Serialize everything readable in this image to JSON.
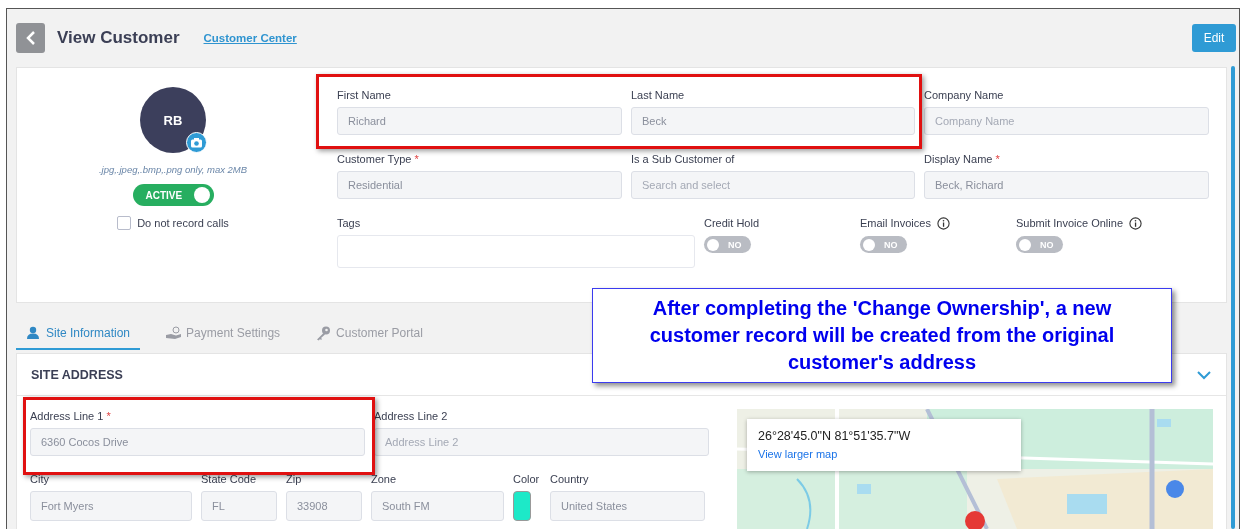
{
  "header": {
    "title": "View Customer",
    "link": "Customer Center",
    "edit_button": "Edit"
  },
  "profile": {
    "initials": "RB",
    "upload_hint": ".jpg,.jpeg,.bmp,.png only, max 2MB",
    "status": {
      "label": "ACTIVE",
      "on": true
    },
    "do_not_record": {
      "label": "Do not record calls",
      "checked": false
    }
  },
  "fields": [
    {
      "label": "First Name",
      "value": "Richard"
    },
    {
      "label": "Last Name",
      "value": "Beck"
    },
    {
      "label": "Company Name",
      "placeholder": "Company Name"
    },
    {
      "label": "Customer Type",
      "required_mark": "*",
      "value": "Residential"
    },
    {
      "label": "Is a Sub Customer of",
      "placeholder": "Search and select"
    },
    {
      "label": "Display Name",
      "required_mark": "*",
      "value": "Beck, Richard"
    }
  ],
  "tags": {
    "label": "Tags"
  },
  "switches": [
    {
      "label": "Credit Hold",
      "info": false,
      "text": "NO",
      "on": false
    },
    {
      "label": "Email Invoices",
      "info": true,
      "text": "NO",
      "on": false
    },
    {
      "label": "Submit Invoice Online",
      "info": true,
      "text": "NO",
      "on": false
    }
  ],
  "tabs": [
    {
      "label": "Site Information",
      "kind": "person",
      "selected": true
    },
    {
      "label": "Payment Settings",
      "kind": "payment",
      "selected": false
    },
    {
      "label": "Customer Portal",
      "kind": "key",
      "selected": false
    }
  ],
  "site_address": {
    "title": "SITE ADDRESS",
    "expanded": true,
    "fields": [
      {
        "label": "Address Line 1",
        "required_mark": "*",
        "value": "6360 Cocos Drive"
      },
      {
        "label": "Address Line 2",
        "placeholder": "Address Line 2"
      }
    ],
    "bottom_fields": [
      {
        "kind": "text",
        "label": "City",
        "value": "Fort Myers"
      },
      {
        "kind": "text",
        "label": "State Code",
        "value": "FL"
      },
      {
        "kind": "text",
        "label": "Zip",
        "value": "33908"
      },
      {
        "kind": "text",
        "label": "Zone",
        "value": "South FM"
      },
      {
        "kind": "color",
        "label": "Color",
        "color": "#1de9c8"
      },
      {
        "kind": "text",
        "label": "Country",
        "value": "United States"
      }
    ],
    "map": {
      "kind": "picture",
      "coordinates": "26°28'45.0\"N 81°51'35.7\"W",
      "link": "View larger map"
    }
  },
  "callout": "After completing the 'Change Ownership', a new customer record will be created from the original customer's address"
}
